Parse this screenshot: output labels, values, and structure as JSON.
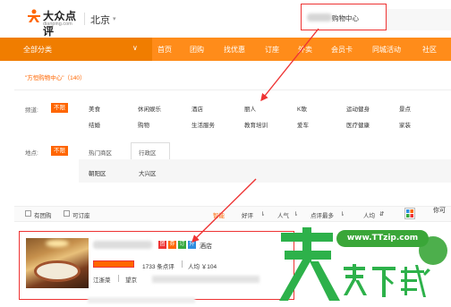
{
  "header": {
    "logo_text": "大众点评",
    "logo_sub": "dianping.com",
    "city": "北京",
    "search_text": "购物中心"
  },
  "nav": {
    "all_categories": "全部分类",
    "items": [
      "首页",
      "团购",
      "找优惠",
      "订座",
      "外卖",
      "会员卡",
      "同城活动",
      "社区"
    ]
  },
  "breadcrumb": "\"方恒购物中心\"（140）",
  "filters": {
    "category": {
      "label": "频道:",
      "tag": "不限",
      "options": [
        "美食",
        "休闲娱乐",
        "酒店",
        "丽人",
        "K歌",
        "运动健身",
        "景点",
        "结婚",
        "购物",
        "生活服务",
        "教育培训",
        "爱车",
        "医疗健康",
        "家装"
      ]
    },
    "area": {
      "label": "地点:",
      "tag": "不限",
      "tabs": [
        "热门商区",
        "行政区"
      ],
      "options": [
        "朝阳区",
        "大兴区"
      ]
    }
  },
  "sortbar": {
    "checkbox_1": "有团购",
    "checkbox_2": "可订座",
    "smart": "智能",
    "sorts": [
      "好评",
      "人气",
      "点评最多",
      "人均"
    ],
    "right_cut": "你可"
  },
  "result": {
    "badges": [
      "团",
      "券",
      "订",
      "外"
    ],
    "badge_colors": [
      "#e33",
      "#f60",
      "#36a93f",
      "#2f8ee0"
    ],
    "name_tail": "酒店",
    "review_count": "1733 条点评",
    "avg_price": "人均 ￥104",
    "addr_1": "江浙菜",
    "addr_2": "望京"
  },
  "watermark": {
    "url": "www.TTzip.com",
    "text": "天天下载"
  },
  "colors": {
    "orange": "#ff8c1a",
    "orange_dark": "#f07d00",
    "annotation_red": "#e33",
    "watermark_green": "#3aa638"
  }
}
